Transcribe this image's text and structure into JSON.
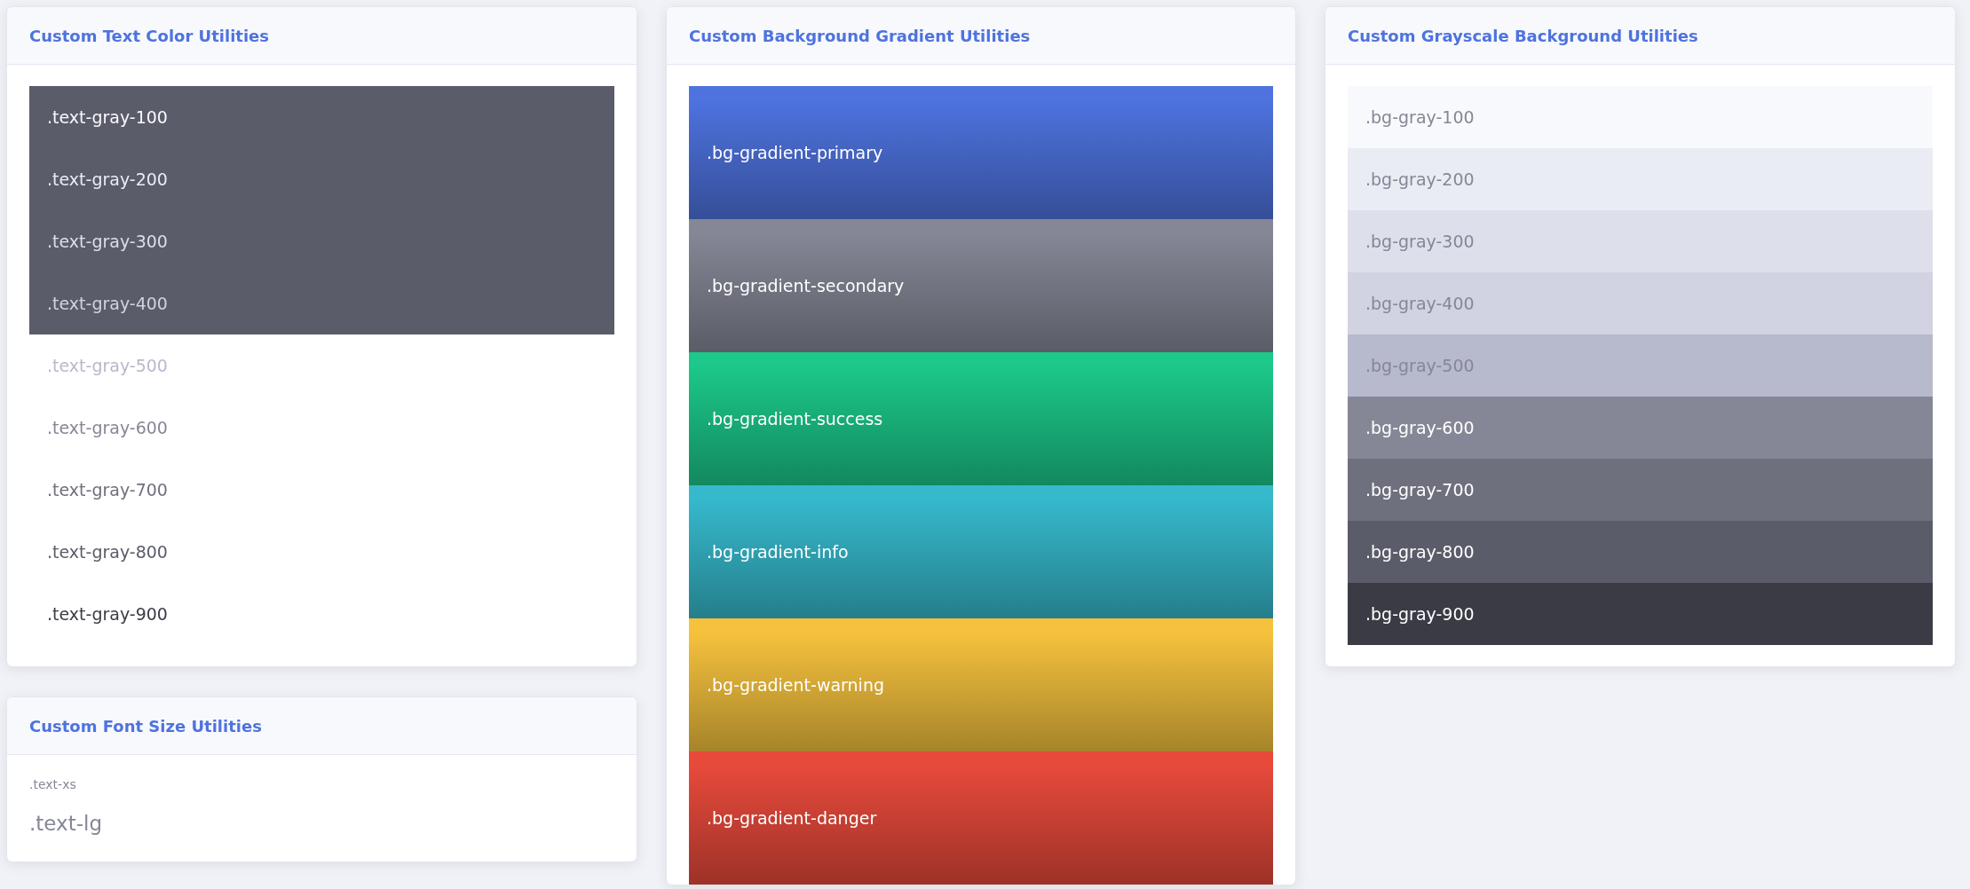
{
  "columns": [
    {
      "cards": [
        {
          "title": "Custom Text Color Utilities",
          "kind": "text_colors",
          "items": [
            {
              "label": ".text-gray-100",
              "color": "#f8f9fc",
              "on_dark": true
            },
            {
              "label": ".text-gray-200",
              "color": "#eaecf4",
              "on_dark": true
            },
            {
              "label": ".text-gray-300",
              "color": "#dddfeb",
              "on_dark": true
            },
            {
              "label": ".text-gray-400",
              "color": "#d1d3e2",
              "on_dark": true
            },
            {
              "label": ".text-gray-500",
              "color": "#b7b9cc",
              "on_dark": false
            },
            {
              "label": ".text-gray-600",
              "color": "#858796",
              "on_dark": false
            },
            {
              "label": ".text-gray-700",
              "color": "#6e707e",
              "on_dark": false
            },
            {
              "label": ".text-gray-800",
              "color": "#5a5c69",
              "on_dark": false
            },
            {
              "label": ".text-gray-900",
              "color": "#3a3b45",
              "on_dark": false
            }
          ]
        },
        {
          "title": "Custom Font Size Utilities",
          "kind": "font_sizes",
          "items": [
            {
              "label": ".text-xs",
              "kind": "xs"
            },
            {
              "label": ".text-lg",
              "kind": "lg"
            }
          ]
        }
      ]
    },
    {
      "cards": [
        {
          "title": "Custom Background Gradient Utilities",
          "kind": "gradients",
          "items": [
            {
              "label": ".bg-gradient-primary",
              "color": "#4e73df"
            },
            {
              "label": ".bg-gradient-secondary",
              "color": "#858796"
            },
            {
              "label": ".bg-gradient-success",
              "color": "#1cc88a"
            },
            {
              "label": ".bg-gradient-info",
              "color": "#36b9cc"
            },
            {
              "label": ".bg-gradient-warning",
              "color": "#f6c23e"
            },
            {
              "label": ".bg-gradient-danger",
              "color": "#e74a3b"
            }
          ]
        }
      ]
    },
    {
      "cards": [
        {
          "title": "Custom Grayscale Background Utilities",
          "kind": "grays",
          "items": [
            {
              "label": ".bg-gray-100",
              "color": "#f8f9fc"
            },
            {
              "label": ".bg-gray-200",
              "color": "#eaecf4"
            },
            {
              "label": ".bg-gray-300",
              "color": "#dddfeb"
            },
            {
              "label": ".bg-gray-400",
              "color": "#d1d3e2"
            },
            {
              "label": ".bg-gray-500",
              "color": "#b7b9cc"
            },
            {
              "label": ".bg-gray-600",
              "color": "#858796"
            },
            {
              "label": ".bg-gray-700",
              "color": "#6e707e"
            },
            {
              "label": ".bg-gray-800",
              "color": "#5a5c69"
            },
            {
              "label": ".bg-gray-900",
              "color": "#3a3b45"
            }
          ]
        }
      ]
    }
  ]
}
